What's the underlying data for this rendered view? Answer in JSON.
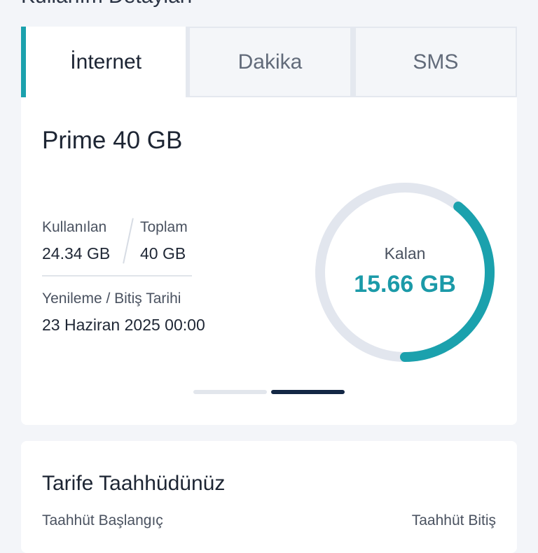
{
  "page": {
    "title": "Kullanım Detayları"
  },
  "tabs": [
    {
      "label": "İnternet",
      "active": true
    },
    {
      "label": "Dakika",
      "active": false
    },
    {
      "label": "SMS",
      "active": false
    }
  ],
  "usage": {
    "plan_name": "Prime 40 GB",
    "used_label": "Kullanılan",
    "used_value": "24.34 GB",
    "total_label": "Toplam",
    "total_value": "40 GB",
    "renewal_label": "Yenileme / Bitiş Tarihi",
    "renewal_value": "23 Haziran 2025 00:00",
    "remaining_label": "Kalan",
    "remaining_value": "15.66 GB",
    "remaining_fraction": 0.3915
  },
  "pagination": {
    "count": 2,
    "active_index": 1
  },
  "commitment": {
    "title": "Tarife Taahhüdünüz",
    "start_label": "Taahhüt Başlangıç",
    "start_value": "",
    "end_label": "Taahhüt Bitiş",
    "end_value": ""
  },
  "colors": {
    "accent": "#1ba1ad",
    "track": "#e2e6ee",
    "dark": "#132744"
  }
}
